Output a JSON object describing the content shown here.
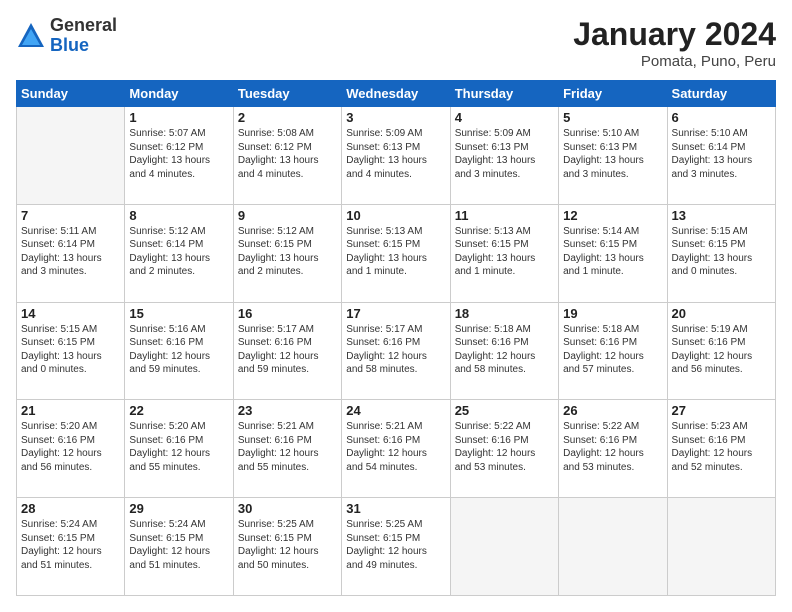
{
  "logo": {
    "general": "General",
    "blue": "Blue"
  },
  "title": "January 2024",
  "subtitle": "Pomata, Puno, Peru",
  "days_header": [
    "Sunday",
    "Monday",
    "Tuesday",
    "Wednesday",
    "Thursday",
    "Friday",
    "Saturday"
  ],
  "weeks": [
    [
      {
        "num": "",
        "info": ""
      },
      {
        "num": "1",
        "info": "Sunrise: 5:07 AM\nSunset: 6:12 PM\nDaylight: 13 hours\nand 4 minutes."
      },
      {
        "num": "2",
        "info": "Sunrise: 5:08 AM\nSunset: 6:12 PM\nDaylight: 13 hours\nand 4 minutes."
      },
      {
        "num": "3",
        "info": "Sunrise: 5:09 AM\nSunset: 6:13 PM\nDaylight: 13 hours\nand 4 minutes."
      },
      {
        "num": "4",
        "info": "Sunrise: 5:09 AM\nSunset: 6:13 PM\nDaylight: 13 hours\nand 3 minutes."
      },
      {
        "num": "5",
        "info": "Sunrise: 5:10 AM\nSunset: 6:13 PM\nDaylight: 13 hours\nand 3 minutes."
      },
      {
        "num": "6",
        "info": "Sunrise: 5:10 AM\nSunset: 6:14 PM\nDaylight: 13 hours\nand 3 minutes."
      }
    ],
    [
      {
        "num": "7",
        "info": "Sunrise: 5:11 AM\nSunset: 6:14 PM\nDaylight: 13 hours\nand 3 minutes."
      },
      {
        "num": "8",
        "info": "Sunrise: 5:12 AM\nSunset: 6:14 PM\nDaylight: 13 hours\nand 2 minutes."
      },
      {
        "num": "9",
        "info": "Sunrise: 5:12 AM\nSunset: 6:15 PM\nDaylight: 13 hours\nand 2 minutes."
      },
      {
        "num": "10",
        "info": "Sunrise: 5:13 AM\nSunset: 6:15 PM\nDaylight: 13 hours\nand 1 minute."
      },
      {
        "num": "11",
        "info": "Sunrise: 5:13 AM\nSunset: 6:15 PM\nDaylight: 13 hours\nand 1 minute."
      },
      {
        "num": "12",
        "info": "Sunrise: 5:14 AM\nSunset: 6:15 PM\nDaylight: 13 hours\nand 1 minute."
      },
      {
        "num": "13",
        "info": "Sunrise: 5:15 AM\nSunset: 6:15 PM\nDaylight: 13 hours\nand 0 minutes."
      }
    ],
    [
      {
        "num": "14",
        "info": "Sunrise: 5:15 AM\nSunset: 6:15 PM\nDaylight: 13 hours\nand 0 minutes."
      },
      {
        "num": "15",
        "info": "Sunrise: 5:16 AM\nSunset: 6:16 PM\nDaylight: 12 hours\nand 59 minutes."
      },
      {
        "num": "16",
        "info": "Sunrise: 5:17 AM\nSunset: 6:16 PM\nDaylight: 12 hours\nand 59 minutes."
      },
      {
        "num": "17",
        "info": "Sunrise: 5:17 AM\nSunset: 6:16 PM\nDaylight: 12 hours\nand 58 minutes."
      },
      {
        "num": "18",
        "info": "Sunrise: 5:18 AM\nSunset: 6:16 PM\nDaylight: 12 hours\nand 58 minutes."
      },
      {
        "num": "19",
        "info": "Sunrise: 5:18 AM\nSunset: 6:16 PM\nDaylight: 12 hours\nand 57 minutes."
      },
      {
        "num": "20",
        "info": "Sunrise: 5:19 AM\nSunset: 6:16 PM\nDaylight: 12 hours\nand 56 minutes."
      }
    ],
    [
      {
        "num": "21",
        "info": "Sunrise: 5:20 AM\nSunset: 6:16 PM\nDaylight: 12 hours\nand 56 minutes."
      },
      {
        "num": "22",
        "info": "Sunrise: 5:20 AM\nSunset: 6:16 PM\nDaylight: 12 hours\nand 55 minutes."
      },
      {
        "num": "23",
        "info": "Sunrise: 5:21 AM\nSunset: 6:16 PM\nDaylight: 12 hours\nand 55 minutes."
      },
      {
        "num": "24",
        "info": "Sunrise: 5:21 AM\nSunset: 6:16 PM\nDaylight: 12 hours\nand 54 minutes."
      },
      {
        "num": "25",
        "info": "Sunrise: 5:22 AM\nSunset: 6:16 PM\nDaylight: 12 hours\nand 53 minutes."
      },
      {
        "num": "26",
        "info": "Sunrise: 5:22 AM\nSunset: 6:16 PM\nDaylight: 12 hours\nand 53 minutes."
      },
      {
        "num": "27",
        "info": "Sunrise: 5:23 AM\nSunset: 6:16 PM\nDaylight: 12 hours\nand 52 minutes."
      }
    ],
    [
      {
        "num": "28",
        "info": "Sunrise: 5:24 AM\nSunset: 6:15 PM\nDaylight: 12 hours\nand 51 minutes."
      },
      {
        "num": "29",
        "info": "Sunrise: 5:24 AM\nSunset: 6:15 PM\nDaylight: 12 hours\nand 51 minutes."
      },
      {
        "num": "30",
        "info": "Sunrise: 5:25 AM\nSunset: 6:15 PM\nDaylight: 12 hours\nand 50 minutes."
      },
      {
        "num": "31",
        "info": "Sunrise: 5:25 AM\nSunset: 6:15 PM\nDaylight: 12 hours\nand 49 minutes."
      },
      {
        "num": "",
        "info": ""
      },
      {
        "num": "",
        "info": ""
      },
      {
        "num": "",
        "info": ""
      }
    ]
  ]
}
